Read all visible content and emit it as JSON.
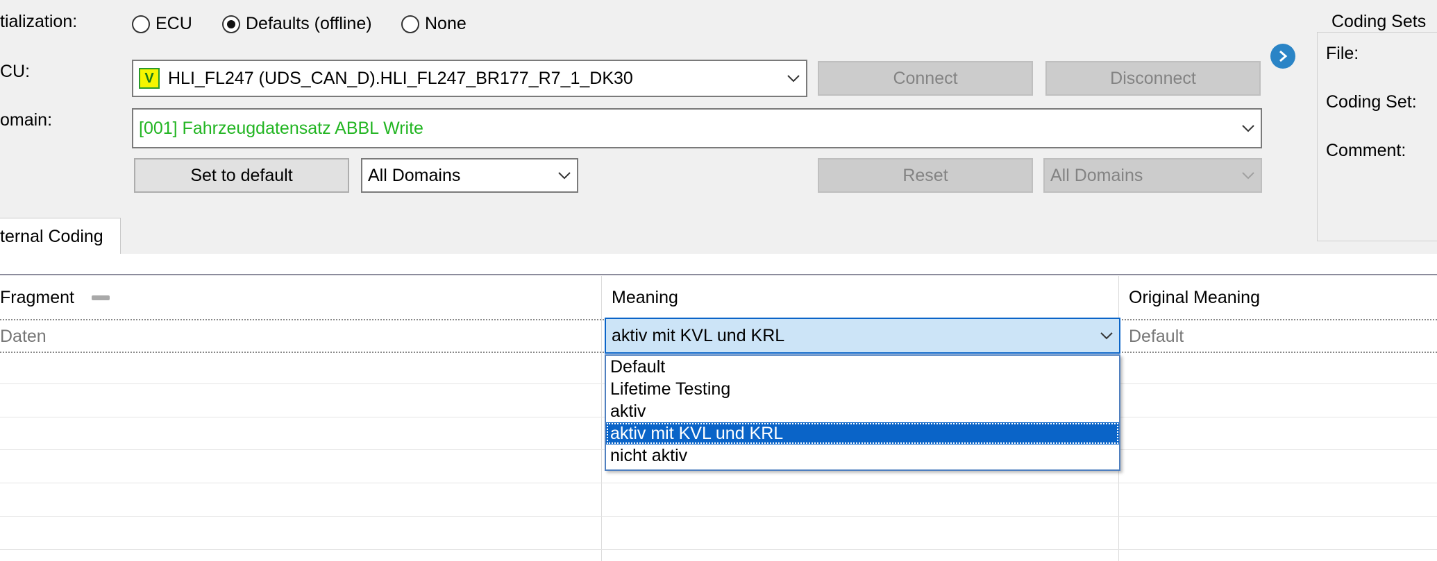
{
  "initialization": {
    "label": "tialization:",
    "options": [
      "ECU",
      "Defaults (offline)",
      "None"
    ],
    "selected": "Defaults (offline)"
  },
  "ecu": {
    "label": "CU:",
    "badge": "V",
    "value": "HLI_FL247 (UDS_CAN_D).HLI_FL247_BR177_R7_1_DK30",
    "connect_label": "Connect",
    "disconnect_label": "Disconnect"
  },
  "domain": {
    "label": "omain:",
    "value": "[001] Fahrzeugdatensatz ABBL Write"
  },
  "controls": {
    "set_default_label": "Set to default",
    "domains_filter": "All Domains",
    "reset_label": "Reset",
    "domains_filter_right": "All Domains"
  },
  "coding_sets": {
    "title": "Coding Sets",
    "file_label": "File:",
    "coding_set_label": "Coding Set:",
    "comment_label": "Comment:"
  },
  "tab": {
    "label": "ternal Coding"
  },
  "table": {
    "columns": [
      "Fragment",
      "Meaning",
      "Original Meaning"
    ],
    "row": {
      "fragment": "Daten",
      "meaning": "aktiv mit KVL und KRL",
      "original": "Default"
    }
  },
  "dropdown": {
    "options": [
      "Default",
      "Lifetime Testing",
      "aktiv",
      "aktiv mit KVL und KRL",
      "nicht aktiv"
    ],
    "selected_index": 3
  },
  "colors": {
    "domain_text": "#22b522",
    "badge_bg": "#f5f500",
    "selection": "#0a64c8",
    "arrow_button": "#2a84c6"
  }
}
